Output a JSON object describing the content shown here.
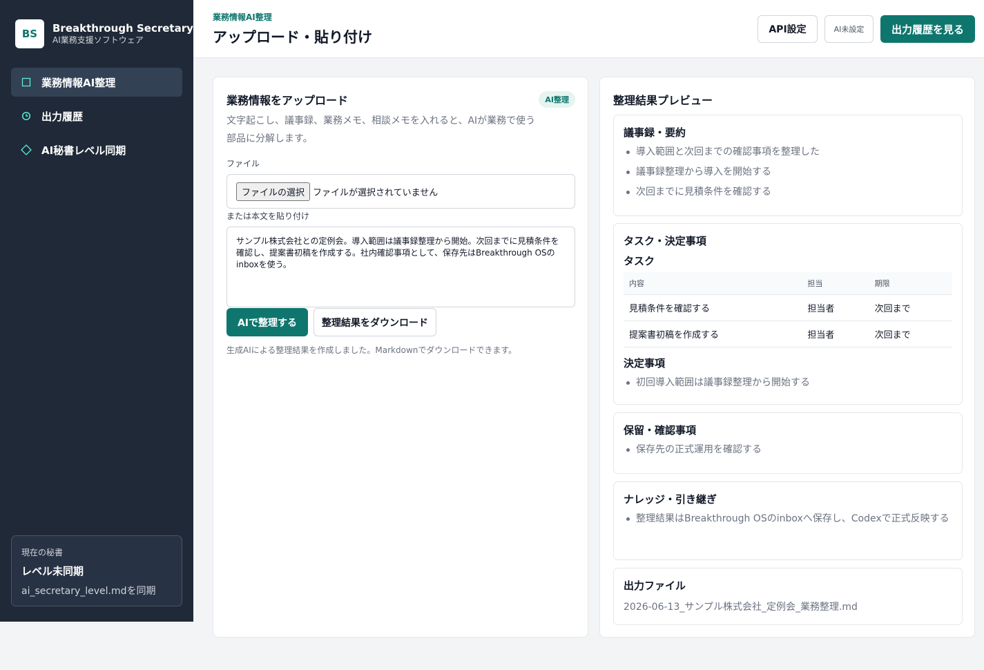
{
  "brand": {
    "logo": "BS",
    "name": "Breakthrough Secretary",
    "subtitle": "AI業務支援ソフトウェア"
  },
  "sidebar": {
    "items": [
      {
        "label": "業務情報AI整理",
        "icon": "square-icon",
        "active": true
      },
      {
        "label": "出力履歴",
        "icon": "clock-icon",
        "active": false
      },
      {
        "label": "AI秘書レベル同期",
        "icon": "diamond-icon",
        "active": false
      }
    ],
    "secretary": {
      "label": "現在の秘書",
      "title": "レベル未同期",
      "sub": "ai_secretary_level.mdを同期"
    }
  },
  "header": {
    "breadcrumb": "業務情報AI整理",
    "title": "アップロード・貼り付け",
    "api_button": "API設定",
    "ai_status": "AI未設定",
    "history_button": "出力履歴を見る"
  },
  "upload": {
    "title": "業務情報をアップロード",
    "badge": "AI整理",
    "description": "文字起こし、議事録、業務メモ、相談メモを入れると、AIが業務で使う部品に分解します。",
    "file_label": "ファイル",
    "file_button": "ファイルの選択",
    "file_status": "ファイルが選択されていません",
    "paste_label": "または本文を貼り付け",
    "paste_text": "サンプル株式会社との定例会。導入範囲は議事録整理から開始。次回までに見積条件を確認し、提案書初稿を作成する。社内確認事項として、保存先はBreakthrough OSのinboxを使う。",
    "organize_button": "AIで整理する",
    "download_button": "整理結果をダウンロード",
    "status": "生成AIによる整理結果を作成しました。Markdownでダウンロードできます。"
  },
  "preview": {
    "title": "整理結果プレビュー",
    "summary": {
      "title": "議事録・要約",
      "items": [
        "導入範囲と次回までの確認事項を整理した",
        "議事録整理から導入を開始する",
        "次回までに見積条件を確認する"
      ]
    },
    "tasks": {
      "title": "タスク・決定事項",
      "task_heading": "タスク",
      "columns": [
        "内容",
        "担当",
        "期限"
      ],
      "rows": [
        [
          "見積条件を確認する",
          "担当者",
          "次回まで"
        ],
        [
          "提案書初稿を作成する",
          "担当者",
          "次回まで"
        ]
      ],
      "decision_heading": "決定事項",
      "decisions": [
        "初回導入範囲は議事録整理から開始する"
      ]
    },
    "pending": {
      "title": "保留・確認事項",
      "items": [
        "保存先の正式運用を確認する"
      ]
    },
    "knowledge": {
      "title": "ナレッジ・引き継ぎ",
      "items": [
        "整理結果はBreakthrough OSのinboxへ保存し、Codexで正式反映する"
      ]
    },
    "output": {
      "title": "出力ファイル",
      "path": "2026-06-13_サンプル株式会社_定例会_業務整理.md"
    }
  },
  "colors": {
    "accent": "#0f766e",
    "sidebar_bg": "#1f2937",
    "badge_bg": "#e6f4f1"
  }
}
